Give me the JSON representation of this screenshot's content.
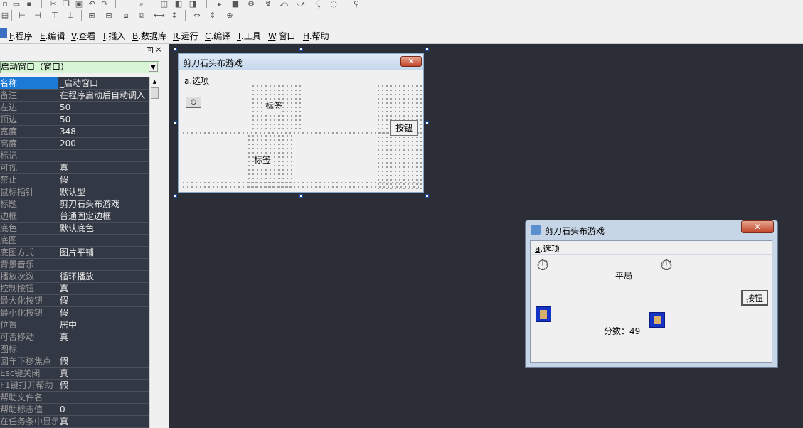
{
  "menubar": {
    "items": [
      {
        "key": "F",
        "label": ".程序"
      },
      {
        "key": "E",
        "label": ".编辑"
      },
      {
        "key": "V",
        "label": ".查看"
      },
      {
        "key": "I",
        "label": ".插入"
      },
      {
        "key": "B",
        "label": ".数据库"
      },
      {
        "key": "R",
        "label": ".运行"
      },
      {
        "key": "C",
        "label": ".编译"
      },
      {
        "key": "T",
        "label": ".工具"
      },
      {
        "key": "W",
        "label": ".窗口"
      },
      {
        "key": "H",
        "label": ".帮助"
      }
    ]
  },
  "property_panel": {
    "combo_value": "启动窗口（窗口）",
    "rows": [
      {
        "name": "名称",
        "value": "_启动窗口"
      },
      {
        "name": "备注",
        "value": "在程序启动后自动调入"
      },
      {
        "name": "左边",
        "value": "50"
      },
      {
        "name": "顶边",
        "value": "50"
      },
      {
        "name": "宽度",
        "value": "348"
      },
      {
        "name": "高度",
        "value": "200"
      },
      {
        "name": "标记",
        "value": ""
      },
      {
        "name": "可视",
        "value": "真"
      },
      {
        "name": "禁止",
        "value": "假"
      },
      {
        "name": "鼠标指针",
        "value": "默认型"
      },
      {
        "name": "标题",
        "value": "剪刀石头布游戏"
      },
      {
        "name": "边框",
        "value": "普通固定边框"
      },
      {
        "name": "底色",
        "value": "默认底色"
      },
      {
        "name": "底图",
        "value": ""
      },
      {
        "name": "  底图方式",
        "value": "图片平铺"
      },
      {
        "name": "背景音乐",
        "value": ""
      },
      {
        "name": "  播放次数",
        "value": "循环播放"
      },
      {
        "name": "控制按钮",
        "value": "真"
      },
      {
        "name": "  最大化按钮",
        "value": "假"
      },
      {
        "name": "  最小化按钮",
        "value": "假"
      },
      {
        "name": "位置",
        "value": "居中"
      },
      {
        "name": "可否移动",
        "value": "真"
      },
      {
        "name": "图标",
        "value": ""
      },
      {
        "name": "回车下移焦点",
        "value": "假"
      },
      {
        "name": "Esc键关闭",
        "value": "真"
      },
      {
        "name": "F1键打开帮助",
        "value": "假"
      },
      {
        "name": "  帮助文件名",
        "value": ""
      },
      {
        "name": "  帮助标志值",
        "value": "0"
      },
      {
        "name": "在任务条中显示",
        "value": "真"
      }
    ]
  },
  "design_form": {
    "title": "剪刀石头布游戏",
    "menu_key": "a",
    "menu_label": ".选项",
    "label1": "标签",
    "label2": "标签",
    "button": "按钮"
  },
  "run_window": {
    "title": "剪刀石头布游戏",
    "menu_key": "a",
    "menu_label": ".选项",
    "result_text": "平局",
    "score_text": "分数：49",
    "button": "按钮"
  },
  "icons": {
    "close": "close-icon",
    "timer": "timer-icon",
    "picture": "picture-box-icon",
    "app": "app-icon"
  },
  "colors": {
    "selected_row": "#1a7ad6",
    "grid_bg": "#333845",
    "combo_bg": "#d7f5d5",
    "workspace": "#2b2e36"
  }
}
